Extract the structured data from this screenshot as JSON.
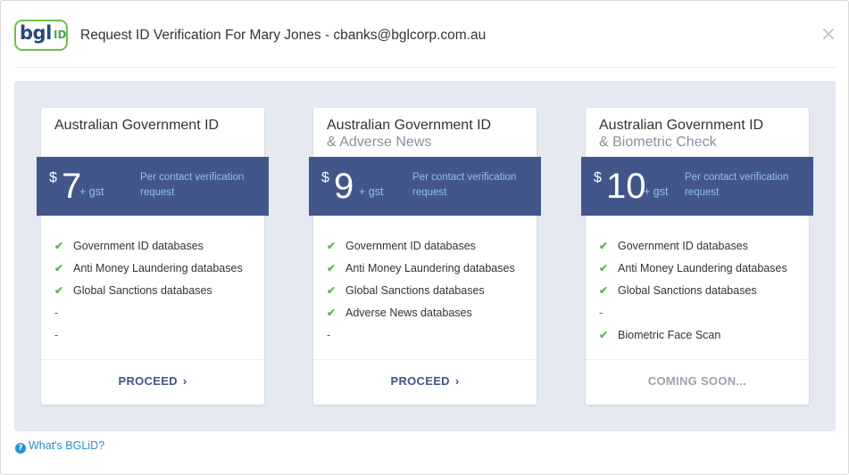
{
  "logo": {
    "brand": "bgl",
    "suffix": "ID"
  },
  "header": {
    "title": "Request ID Verification For Mary Jones - cbanks@bglcorp.com.au",
    "close_icon": "×"
  },
  "colors": {
    "band": "#43568a",
    "check": "#5cb85c",
    "panel": "#e4e9f2",
    "link": "#2a8fd0",
    "logo_green": "#6cbf4a"
  },
  "plans": [
    {
      "title": "Australian Government ID",
      "subtitle": "",
      "currency": "$",
      "price": "7",
      "gst": "+ gst",
      "note": "Per contact verification request",
      "features": [
        {
          "text": "Government ID databases",
          "included": true
        },
        {
          "text": "Anti Money Laundering databases",
          "included": true
        },
        {
          "text": "Global Sanctions databases",
          "included": true
        },
        {
          "text": "-",
          "included": false
        },
        {
          "text": "-",
          "included": false
        }
      ],
      "action": {
        "label": "PROCEED",
        "icon": "chevron-right-icon",
        "enabled": true
      }
    },
    {
      "title": "Australian Government ID",
      "subtitle": "& Adverse News",
      "currency": "$",
      "price": "9",
      "gst": "+ gst",
      "note": "Per contact verification request",
      "features": [
        {
          "text": "Government ID databases",
          "included": true
        },
        {
          "text": "Anti Money Laundering databases",
          "included": true
        },
        {
          "text": "Global Sanctions databases",
          "included": true
        },
        {
          "text": "Adverse News databases",
          "included": true
        },
        {
          "text": "-",
          "included": false
        }
      ],
      "action": {
        "label": "PROCEED",
        "icon": "chevron-right-icon",
        "enabled": true
      }
    },
    {
      "title": "Australian Government ID",
      "subtitle": "& Biometric Check",
      "currency": "$",
      "price": "10",
      "gst": "+ gst",
      "note": "Per contact verification request",
      "features": [
        {
          "text": "Government ID databases",
          "included": true
        },
        {
          "text": "Anti Money Laundering databases",
          "included": true
        },
        {
          "text": "Global Sanctions databases",
          "included": true
        },
        {
          "text": "-",
          "included": false
        },
        {
          "text": "Biometric Face Scan",
          "included": true
        }
      ],
      "action": {
        "label": "COMING SOON...",
        "icon": "",
        "enabled": false
      }
    }
  ],
  "footer": {
    "help_label": "What's BGLiD?",
    "help_icon": "question-circle-icon"
  }
}
